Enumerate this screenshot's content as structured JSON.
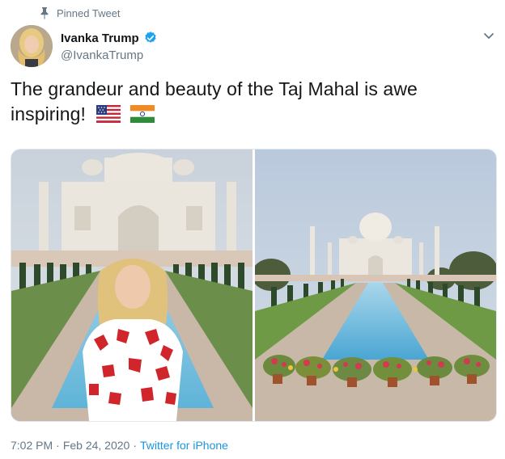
{
  "pinned_label": "Pinned Tweet",
  "author": {
    "display_name": "Ivanka Trump",
    "handle": "@IvankaTrump",
    "verified": true
  },
  "tweet": {
    "text": "The grandeur and beauty of the Taj Mahal is awe inspiring!",
    "emoji": [
      "us-flag-icon",
      "india-flag-icon"
    ]
  },
  "meta": {
    "time": "7:02 PM",
    "separator": "·",
    "date": "Feb 24, 2020",
    "source": "Twitter for iPhone"
  },
  "icons": {
    "pin": "pin-icon",
    "verified": "verified-badge-icon",
    "menu": "chevron-down-icon"
  },
  "colors": {
    "link": "#1b95e0",
    "muted": "#657786",
    "text": "#14171a",
    "verified": "#1da1f2"
  }
}
